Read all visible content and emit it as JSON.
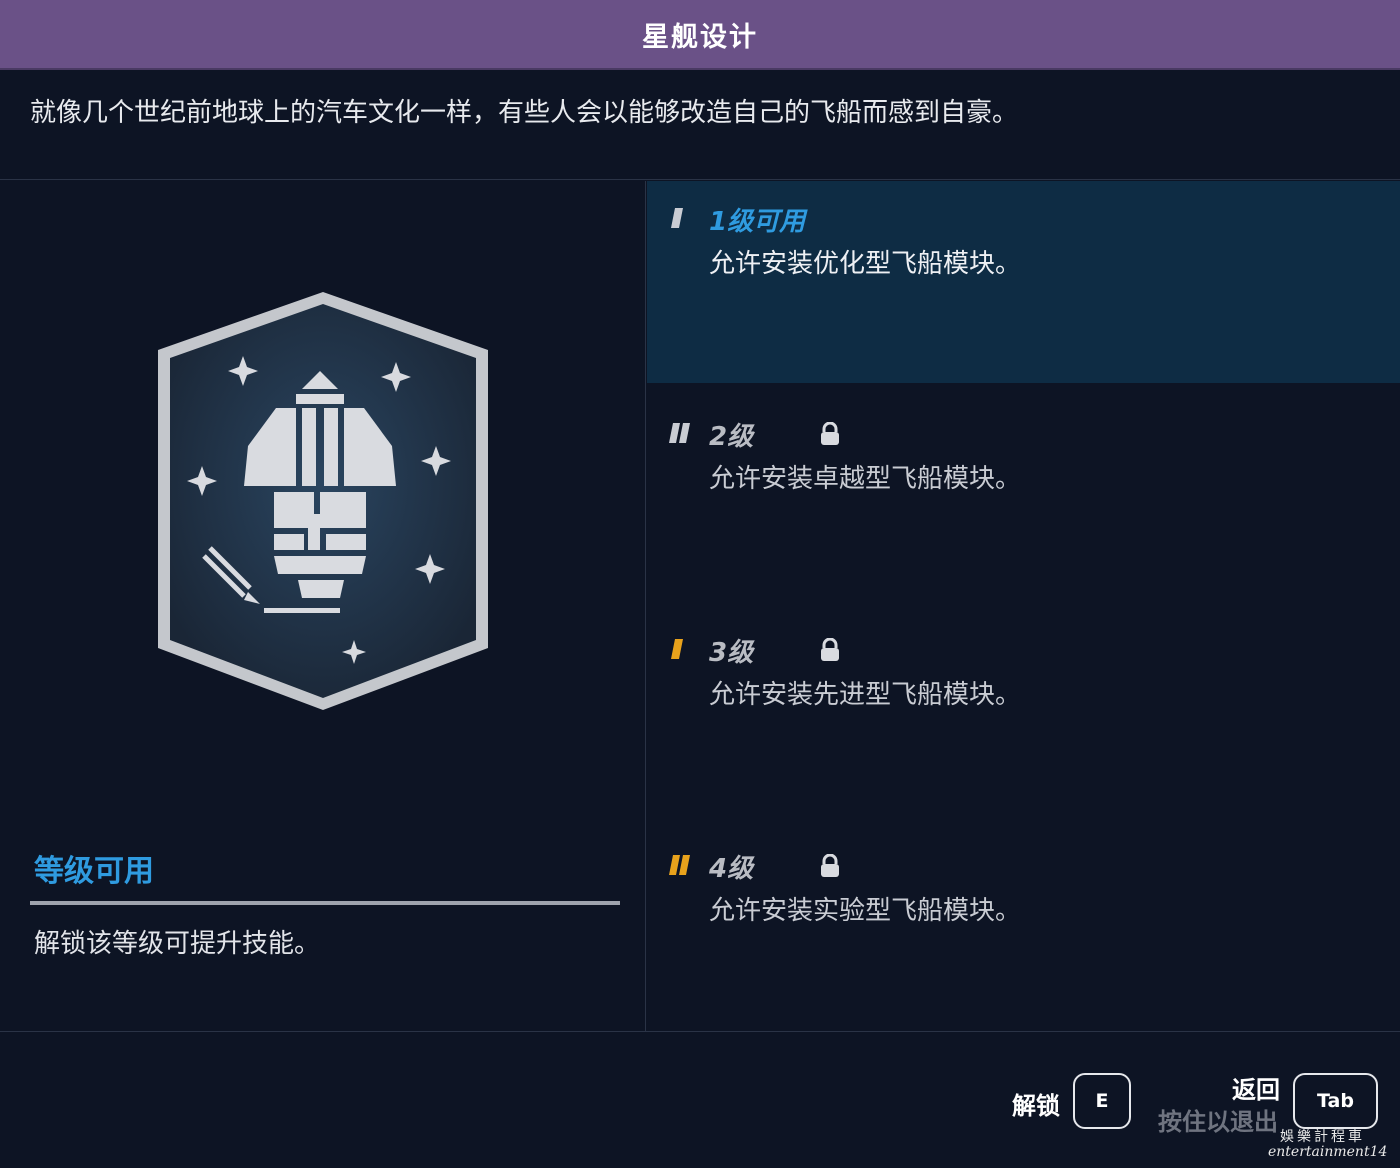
{
  "header": {
    "title": "星舰设计"
  },
  "skill": {
    "description": "就像几个世纪前地球上的汽车文化一样，有些人会以能够改造自己的飞船而感到自豪。",
    "badge_icon": "starship-design-badge-icon"
  },
  "status": {
    "title": "等级可用",
    "description": "解锁该等级可提升技能。",
    "accent": "#2f9be0"
  },
  "ranks": [
    {
      "label": "1级可用",
      "description": "允许安装优化型飞船模块。",
      "locked": false,
      "active": true,
      "marker_color": "#c9ccd3",
      "marker_count": 1
    },
    {
      "label": "2级",
      "description": "允许安装卓越型飞船模块。",
      "locked": true,
      "active": false,
      "marker_color": "#c9ccd3",
      "marker_count": 2
    },
    {
      "label": "3级",
      "description": "允许安装先进型飞船模块。",
      "locked": true,
      "active": false,
      "marker_color": "#e8a21c",
      "marker_count": 1
    },
    {
      "label": "4级",
      "description": "允许安装实验型飞船模块。",
      "locked": true,
      "active": false,
      "marker_color": "#e8a21c",
      "marker_count": 2
    }
  ],
  "footer": {
    "unlock_label": "解锁",
    "unlock_key": "E",
    "back_label": "返回",
    "back_hold_label": "按住以退出",
    "back_key": "Tab"
  },
  "watermark": {
    "line1": "娛樂計程車",
    "line2": "entertainment14"
  }
}
